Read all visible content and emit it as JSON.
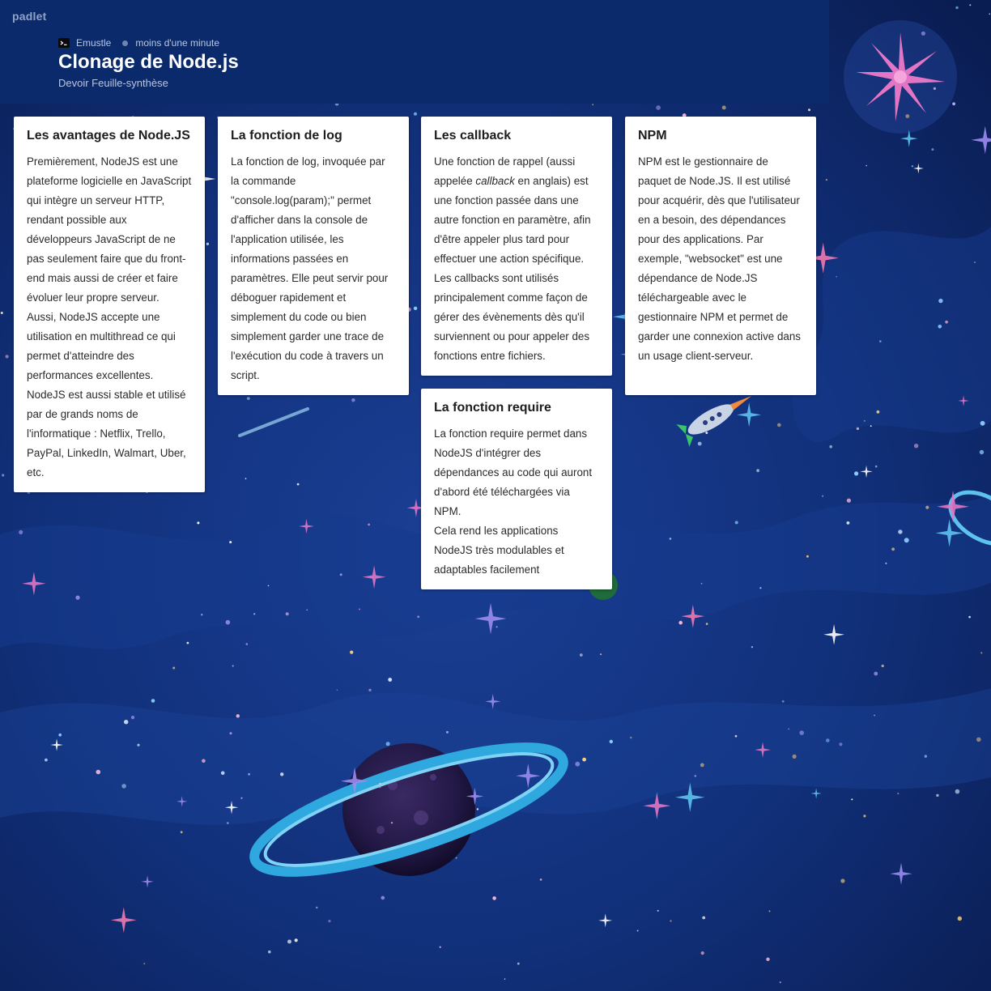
{
  "app": {
    "brand": "padlet"
  },
  "header": {
    "author": "Emustle",
    "time": "moins d'une minute",
    "title": "Clonage de Node.js",
    "subtitle": "Devoir Feuille-synthèse"
  },
  "icons": {
    "author_icon": "terminal-icon"
  },
  "colors": {
    "header_bg": "#0b2a6b",
    "card_bg": "#ffffff",
    "space_bg": "#0f2a6e"
  },
  "cards": [
    {
      "title": "Les avantages de Node.JS",
      "paragraphs": [
        "Premièrement, NodeJS est une plateforme logicielle en JavaScript qui intègre un serveur HTTP, rendant possible aux développeurs JavaScript de ne pas seulement faire que du front-end mais aussi de créer et faire évoluer leur propre serveur.",
        "Aussi, NodeJS accepte une utilisation en multithread ce qui permet d'atteindre des performances excellentes.",
        "NodeJS est aussi stable et utilisé par de grands noms de l'informatique : Netflix, Trello, PayPal, LinkedIn, Walmart, Uber, etc."
      ]
    },
    {
      "title": "La fonction de log",
      "paragraphs": [
        "La fonction de log, invoquée par la commande \"console.log(param);\" permet d'afficher dans la console de l'application utilisée, les informations passées en paramètres. Elle peut servir pour déboguer rapidement et simplement du code ou bien simplement garder une trace de l'exécution du code à travers un script."
      ]
    },
    {
      "title": "Les callback",
      "p1_before": "Une fonction de rappel (aussi appelée ",
      "p1_em": "callback",
      "p1_after": " en anglais) est une fonction passée dans une autre fonction en paramètre, afin d'être appeler plus tard pour effectuer une action spécifique.",
      "p2": "Les callbacks sont utilisés principalement comme façon de gérer des évènements dès qu'il surviennent ou pour appeler des fonctions entre fichiers."
    },
    {
      "title": "La fonction require",
      "paragraphs": [
        "La fonction require permet dans NodeJS d'intégrer des dépendances au code qui auront d'abord été téléchargées via NPM.",
        "Cela rend les applications NodeJS très modulables et adaptables facilement"
      ]
    },
    {
      "title": "NPM",
      "paragraphs": [
        "NPM est le gestionnaire de paquet de Node.JS. Il est utilisé pour acquérir, dès que l'utilisateur en a besoin, des dépendances pour des applications. Par exemple, \"websocket\" est une dépendance de Node.JS téléchargeable avec le gestionnaire NPM et permet de garder une connexion active dans un usage client-serveur."
      ]
    }
  ]
}
